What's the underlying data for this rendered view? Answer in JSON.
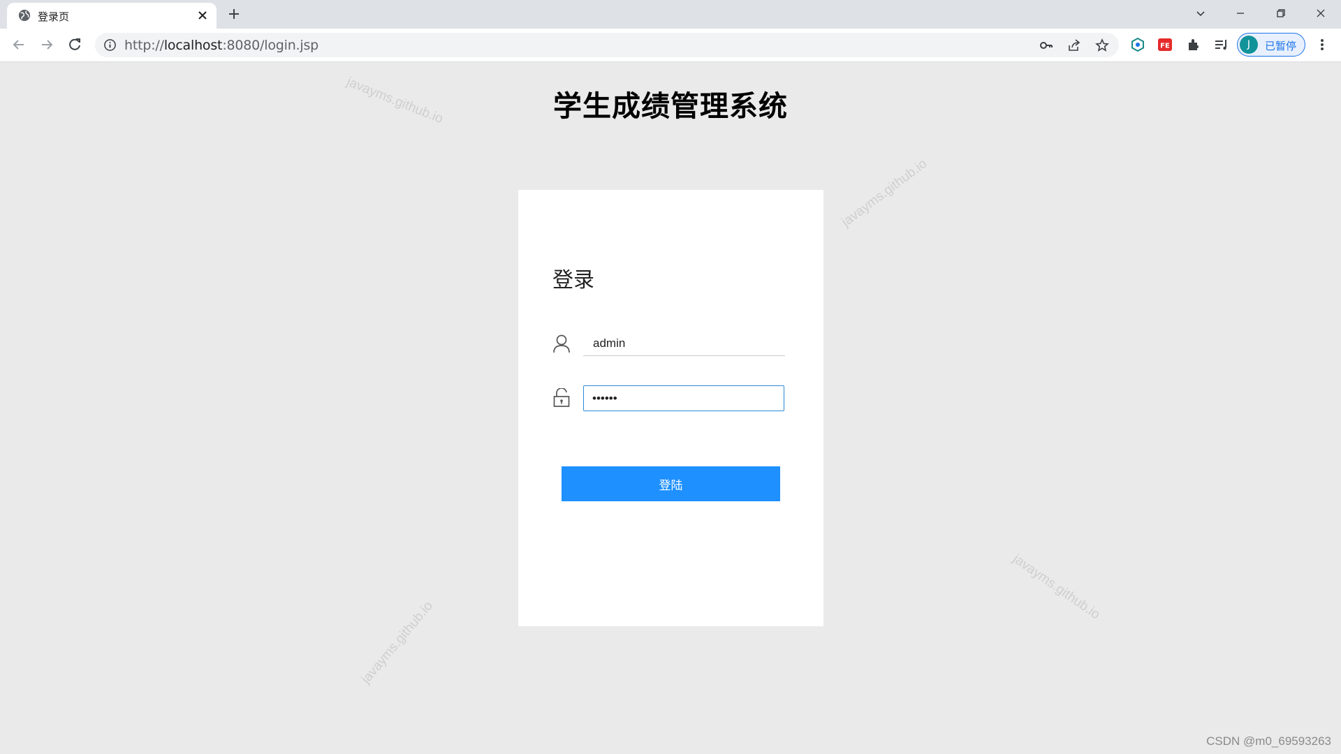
{
  "browser": {
    "tab_title": "登录页",
    "url_prefix": "http://",
    "url_host": "localhost",
    "url_rest": ":8080/login.jsp",
    "profile_initial": "J",
    "profile_status": "已暂停",
    "accent_color": "#1a73e8"
  },
  "page": {
    "heading": "学生成绩管理系统",
    "background_color": "#eaeaea"
  },
  "login": {
    "title": "登录",
    "username_value": "admin",
    "password_value": "••••••",
    "button_label": "登陆",
    "button_color": "#1e90ff",
    "username_icon": "user-icon",
    "password_icon": "unlock-icon"
  },
  "watermarks": [
    "javayms.github.io",
    "javayms.github.io",
    "javayms.github.io",
    "javayms.github.io"
  ],
  "footer_mark": "CSDN @m0_69593263"
}
